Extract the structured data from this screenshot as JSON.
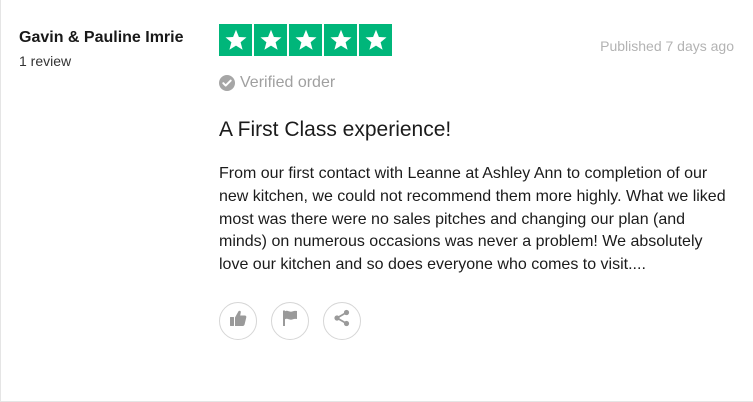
{
  "consumer": {
    "name": "Gavin & Pauline Imrie",
    "review_count": "1 review"
  },
  "review": {
    "rating": 5,
    "max_rating": 5,
    "star_color": "#00b67a",
    "published": "Published 7 days ago",
    "verified_label": "Verified order",
    "title": "A First Class experience!",
    "body": "From our first contact with Leanne at Ashley Ann to completion of our new kitchen, we could not recommend them more highly. What we liked most was there were no sales pitches and changing our plan (and minds) on numerous occasions was never a problem! We absolutely love our kitchen and so does everyone who comes to visit...."
  },
  "actions": [
    {
      "icon": "thumbs-up-icon"
    },
    {
      "icon": "flag-icon"
    },
    {
      "icon": "share-icon"
    }
  ]
}
